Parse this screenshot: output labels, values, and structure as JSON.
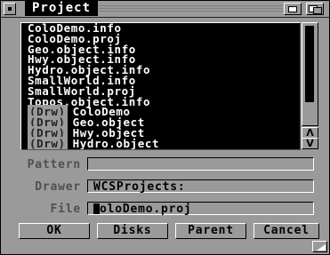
{
  "window": {
    "title": "Project"
  },
  "list": {
    "items": [
      {
        "tag": "",
        "name": "ColoDemo.info"
      },
      {
        "tag": "",
        "name": "ColoDemo.proj"
      },
      {
        "tag": "",
        "name": "Geo.object.info"
      },
      {
        "tag": "",
        "name": "Hwy.object.info"
      },
      {
        "tag": "",
        "name": "Hydro.object.info"
      },
      {
        "tag": "",
        "name": "SmallWorld.info"
      },
      {
        "tag": "",
        "name": "SmallWorld.proj"
      },
      {
        "tag": "",
        "name": "Topos.object.info"
      },
      {
        "tag": "(Drw)",
        "name": "ColoDemo"
      },
      {
        "tag": "(Drw)",
        "name": "Geo.object"
      },
      {
        "tag": "(Drw)",
        "name": "Hwy.object"
      },
      {
        "tag": "(Drw)",
        "name": "Hydro.object"
      }
    ]
  },
  "scrollbar": {
    "up_arrow": "Λ",
    "down_arrow": "V"
  },
  "fields": {
    "pattern_label": "Pattern",
    "pattern_value": "",
    "drawer_label": "Drawer",
    "drawer_value": "WCSProjects:",
    "file_label": "File",
    "file_value": "oloDemo.proj"
  },
  "buttons": {
    "ok": "OK",
    "disks": "Disks",
    "parent": "Parent",
    "cancel": "Cancel"
  },
  "icons": {
    "close": "close-gadget",
    "depth": "depth-gadget",
    "zoom": "zoom-gadget",
    "resize": "size-gadget"
  },
  "colors": {
    "window_bg": "#9a9a9a",
    "list_bg": "#000000",
    "list_text": "#ffffff",
    "label_text": "#505050"
  }
}
